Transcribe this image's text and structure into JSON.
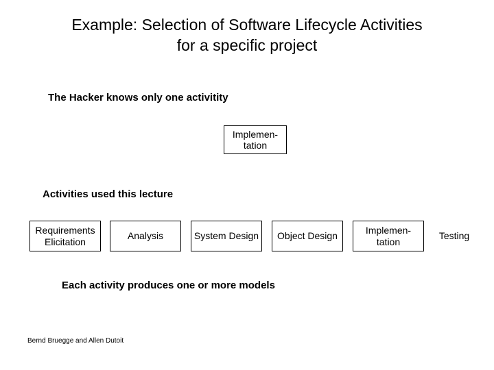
{
  "title_line1": "Example: Selection of Software Lifecycle Activities",
  "title_line2": "for a specific project",
  "hacker_label": "The Hacker knows only one activitity",
  "hacker_box": "Implemen-tation",
  "lecture_label": "Activities used  this lecture",
  "boxes": {
    "b1": "Requirements Elicitation",
    "b2": "Analysis",
    "b3": "System Design",
    "b4": "Object Design",
    "b5": "Implemen-tation",
    "b6": "Testing"
  },
  "footnote": "Each activity produces one or more models",
  "authors": "Bernd Bruegge and Allen Dutoit"
}
